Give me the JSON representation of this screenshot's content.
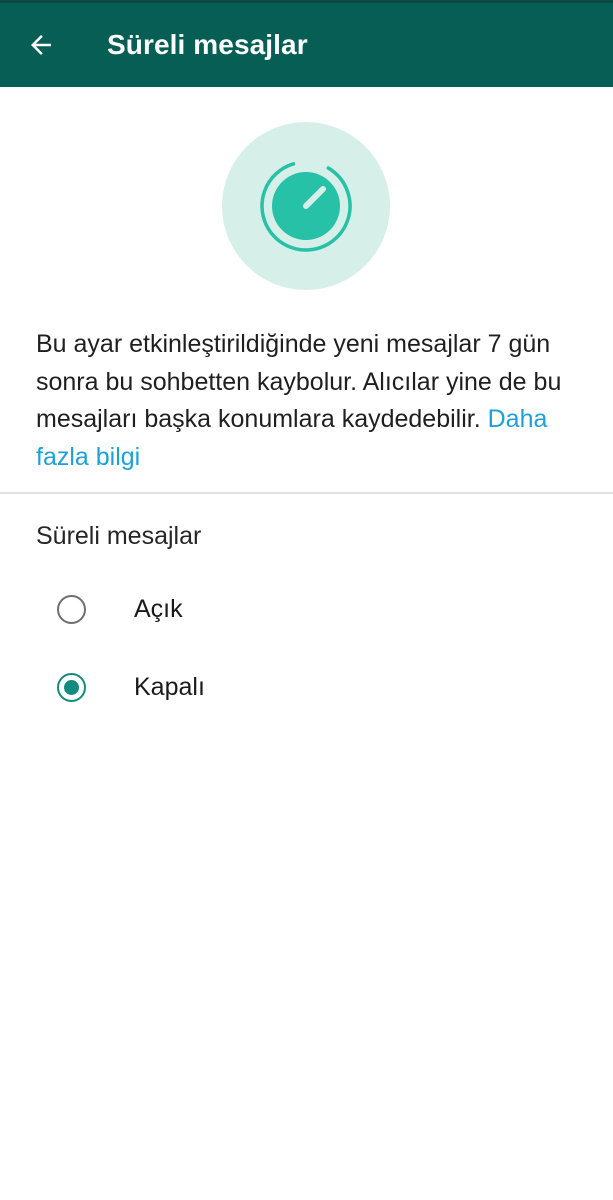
{
  "appbar": {
    "title": "Süreli mesajlar",
    "back_icon": "arrow-left-icon",
    "background_color": "#075e54"
  },
  "hero": {
    "icon": "timer-icon",
    "circle_color": "#d6efe9",
    "icon_color": "#26c1a6"
  },
  "description": {
    "text": "Bu ayar etkinleştirildiğinde yeni mesajlar 7 gün sonra bu sohbetten kaybolur. Alıcılar yine de bu mesajları başka konumlara kaydedebilir. ",
    "link": "Daha fazla bilgi",
    "link_color": "#1da1d6"
  },
  "settings": {
    "section_label": "Süreli mesajlar",
    "options": [
      {
        "label": "Açık",
        "selected": false
      },
      {
        "label": "Kapalı",
        "selected": true
      }
    ],
    "accent_color": "#128c7e"
  }
}
